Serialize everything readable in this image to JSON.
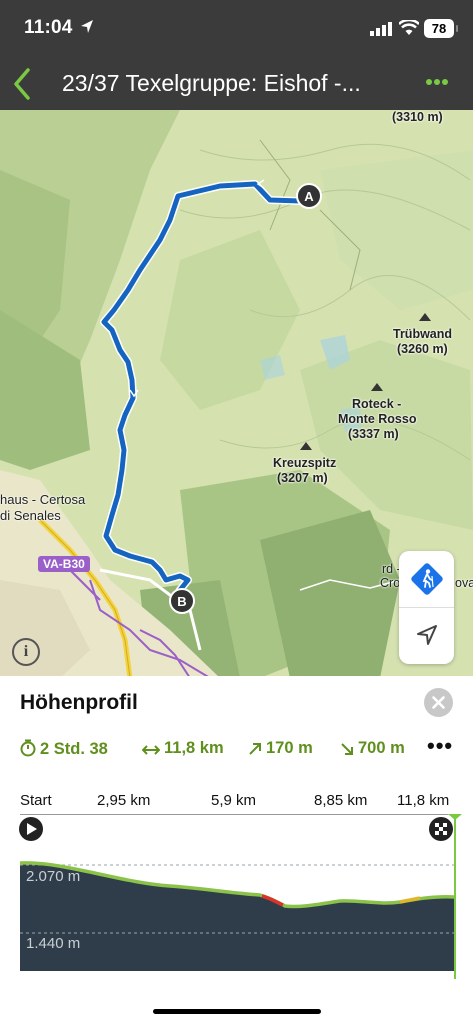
{
  "status_bar": {
    "time": "11:04",
    "battery": "78"
  },
  "header": {
    "title": "23/37 Texelgruppe: Eishof -..."
  },
  "map": {
    "labels": {
      "top_peak": "(3310 m)",
      "truebwand_name": "Trübwand",
      "truebwand_elev": "(3260 m)",
      "roteck_name_1": "Roteck -",
      "roteck_name_2": "Monte Rosso",
      "roteck_elev": "(3337 m)",
      "kreuzspitz_name": "Kreuzspitz",
      "kreuzspitz_elev": "(3207 m)",
      "karthaus_1": "haus - Certosa",
      "karthaus_2": "di Senales",
      "road": "VA-B30",
      "partial_1": "rd -",
      "partial_2": "Cro",
      "partial_3": "ova"
    },
    "markers": {
      "start": "A",
      "end": "B"
    },
    "info": "i"
  },
  "profile": {
    "title": "Höhenprofil",
    "stats": {
      "duration": "2 Std. 38",
      "distance": "11,8 km",
      "ascent": "170 m",
      "descent": "700 m"
    },
    "axis_ticks": [
      "Start",
      "2,95 km",
      "5,9 km",
      "8,85 km",
      "11,8 km"
    ],
    "elevation_labels": [
      "2.070 m",
      "1.440 m"
    ]
  },
  "colors": {
    "route": "#1565c0",
    "accent": "#5f8f1d",
    "dark": "#3b3b3b",
    "profile_fill": "#2f3d4a"
  }
}
